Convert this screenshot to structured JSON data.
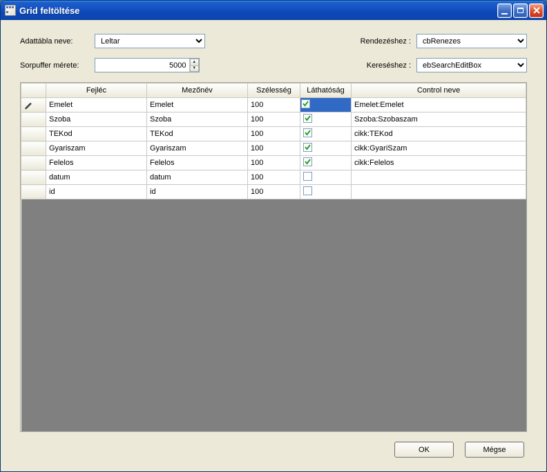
{
  "window": {
    "title": "Grid feltöltése"
  },
  "labels": {
    "adattabla": "Adattábla neve:",
    "sorpuffer": "Sorpuffer mérete:",
    "rendezeshez": "Rendezéshez :",
    "kereseshez": "Kereséshez :"
  },
  "inputs": {
    "adattabla_value": "Leltar",
    "sorpuffer_value": "5000",
    "rendezeshez_value": "cbRenezes",
    "kereseshez_value": "ebSearchEditBox"
  },
  "grid": {
    "headers": {
      "fejlec": "Fejléc",
      "mezonev": "Mezőnév",
      "szelesseg": "Szélesség",
      "lathatosag": "Láthatóság",
      "control": "Control neve"
    },
    "rows": [
      {
        "fejlec": "Emelet",
        "mezonev": "Emelet",
        "szelesseg": "100",
        "lathato": true,
        "control": "Emelet:Emelet",
        "active": true,
        "cb_selected": true
      },
      {
        "fejlec": "Szoba",
        "mezonev": "Szoba",
        "szelesseg": "100",
        "lathato": true,
        "control": "Szoba:Szobaszam",
        "active": false,
        "cb_selected": false
      },
      {
        "fejlec": "TEKod",
        "mezonev": "TEKod",
        "szelesseg": "100",
        "lathato": true,
        "control": "cikk:TEKod",
        "active": false,
        "cb_selected": false
      },
      {
        "fejlec": "Gyariszam",
        "mezonev": "Gyariszam",
        "szelesseg": "100",
        "lathato": true,
        "control": "cikk:GyariSzam",
        "active": false,
        "cb_selected": false
      },
      {
        "fejlec": "Felelos",
        "mezonev": "Felelos",
        "szelesseg": "100",
        "lathato": true,
        "control": "cikk:Felelos",
        "active": false,
        "cb_selected": false
      },
      {
        "fejlec": "datum",
        "mezonev": "datum",
        "szelesseg": "100",
        "lathato": false,
        "control": "",
        "active": false,
        "cb_selected": false
      },
      {
        "fejlec": "id",
        "mezonev": "id",
        "szelesseg": "100",
        "lathato": false,
        "control": "",
        "active": false,
        "cb_selected": false
      }
    ]
  },
  "buttons": {
    "ok": "OK",
    "cancel": "Mégse"
  }
}
